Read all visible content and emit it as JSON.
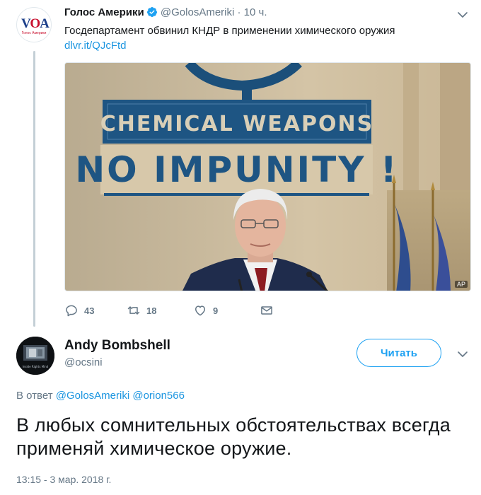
{
  "parent_tweet": {
    "author_name": "Голос Америки",
    "author_handle": "@GolosAmeriki",
    "separator": "·",
    "time_ago": "10 ч.",
    "text": "Госдепартамент обвинил КНДР в применении химического оружия",
    "link": "dlvr.it/QJcFtd",
    "avatar": {
      "logo_text_1": "V",
      "logo_text_2": "O",
      "logo_text_3": "A",
      "logo_sub": "Голос Америки"
    },
    "image": {
      "banner_line_1": "CHEMICAL WEAPONS",
      "banner_line_2": "NO IMPUNITY !",
      "caption": "AP"
    },
    "actions": {
      "replies": "43",
      "retweets": "18",
      "likes": "9"
    },
    "colors": {
      "verified": "#1da1f2",
      "link": "#1b95e0"
    }
  },
  "reply_tweet": {
    "author_name": "Andy Bombshell",
    "author_handle": "@ocsini",
    "follow_label": "Читать",
    "reply_prefix": "В ответ",
    "mention_1": "@GolosAmeriki",
    "mention_2": "@orion566",
    "text": "В любых сомнительных обстоятельствах всегда применяй химическое оружие.",
    "timestamp": "13:15 - 3 мар. 2018 г.",
    "avatar": {
      "caption": "Inside Rights Mind"
    }
  },
  "icons": {
    "chevron": "chevron-down-icon",
    "reply": "reply-icon",
    "retweet": "retweet-icon",
    "like": "heart-icon",
    "dm": "envelope-icon",
    "verified": "verified-badge-icon"
  }
}
